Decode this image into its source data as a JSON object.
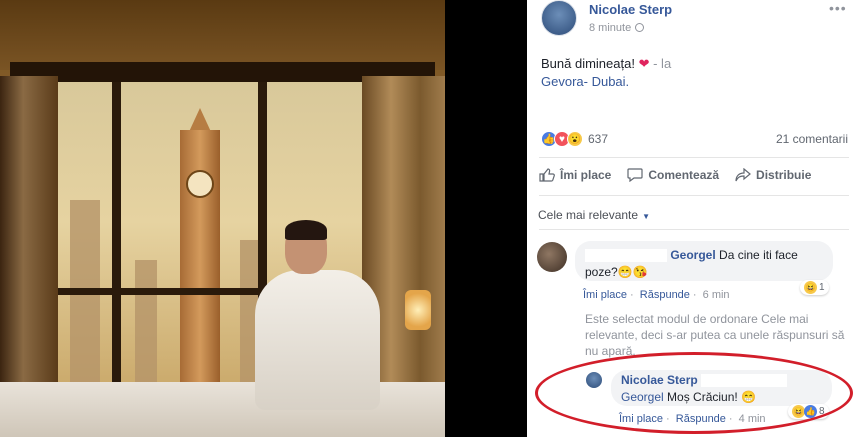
{
  "post": {
    "author": "Nicolae Sterp",
    "time": "8 minute",
    "options_glyph": "•••",
    "text_line1": "Bună dimineața!",
    "heart": "❤",
    "text_suffix": "- la",
    "location": "Gevora- Dubai.",
    "reactions_count": "637",
    "comments_count": "21 comentarii"
  },
  "actions": {
    "like": "Îmi place",
    "comment": "Comentează",
    "share": "Distribuie"
  },
  "sort": {
    "label": "Cele mai relevante"
  },
  "comment1": {
    "author": "Georgel",
    "text_start": "Da cine iti face",
    "text_end": "poze?",
    "emojis": "😁😘",
    "like": "Îmi place",
    "reply": "Răspunde",
    "time": "6 min",
    "reaction_count": "1"
  },
  "notice": {
    "text": "Este selectat modul de ordonare Cele mai relevante, deci s-ar putea ca unele răspunsuri să nu apară."
  },
  "reply1": {
    "author": "Nicolae Sterp",
    "mention": "Georgel",
    "text": "Moș Crăciun!",
    "emoji": "😁",
    "like": "Îmi place",
    "reply": "Răspunde",
    "time": "4 min",
    "reaction_count": "8"
  },
  "colors": {
    "link": "#365899",
    "highlight": "#d21e2a"
  }
}
